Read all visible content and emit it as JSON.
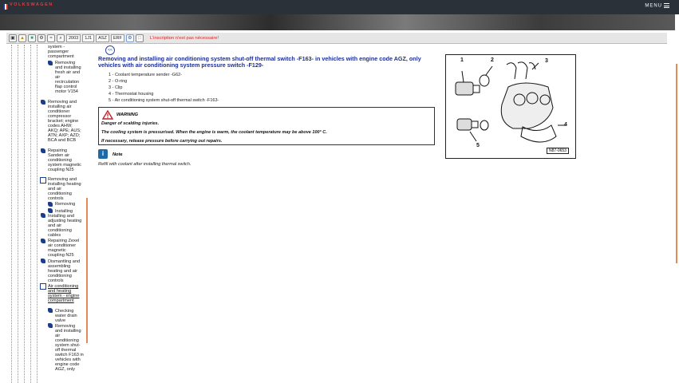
{
  "header": {
    "brand": "VOLKSWAGEN",
    "menu_label": "MENU"
  },
  "toolbar": {
    "icons": [
      "car-icon",
      "warning-icon",
      "engine-icon",
      "gearbox-icon",
      "wiring-icon",
      "search-icon"
    ],
    "year": "2003",
    "model": "1J1",
    "engine": "ASZ",
    "gearbox": "ERF",
    "register_note": "L'inscription n'est pas nécessaire!"
  },
  "tree": {
    "nodes": [
      {
        "text": "system - passenger compartment",
        "level": 1,
        "icon": "none"
      },
      {
        "text": "Removing and installing fresh air and air recirculation flap control motor V154",
        "level": 2,
        "icon": "blue"
      },
      {
        "text": "Removing and installing air conditioner compressor bracket; engine codes AHW; AKQ; APE; AUS; ATN; AXP; AZD; BCA and BCB",
        "level": 1,
        "icon": "blue"
      },
      {
        "text": "Repairing Sanden air conditioning system magnetic coupling N25",
        "level": 1,
        "icon": "blue"
      },
      {
        "text": "Removing and installing heating and air conditioning controls",
        "level": 1,
        "icon": "open"
      },
      {
        "text": "Removing",
        "level": 2,
        "icon": "blue"
      },
      {
        "text": "Installing",
        "level": 2,
        "icon": "blue"
      },
      {
        "text": "Installing and adjusting heating and air conditioning cables",
        "level": 1,
        "icon": "blue"
      },
      {
        "text": "Repairing Zexel air conditioner magnetic coupling N25",
        "level": 1,
        "icon": "blue"
      },
      {
        "text": "Dismantling and assembling heating and air conditioning controls",
        "level": 1,
        "icon": "blue"
      },
      {
        "text": "Air conditioning and heating system - engine compartment",
        "level": 1,
        "icon": "open",
        "link": true
      },
      {
        "text": "Checking water drain valve",
        "level": 2,
        "icon": "blue"
      },
      {
        "text": "Removing and installing air conditioning system shut-off thermal switch F163 in vehicles with engine code AGZ, only",
        "level": 2,
        "icon": "blue"
      }
    ]
  },
  "content": {
    "back_label": "<<",
    "title": "Removing and installing air conditioning system shut-off thermal switch -F163- in vehicles with engine code AGZ, only vehicles with air conditioning system pressure switch -F129-",
    "legend": [
      "1 - Coolant temperature sender -G62-",
      "2 - O-ring",
      "3 - Clip",
      "4 - Thermostat housing",
      "5 - Air conditioning system shut-off thermal switch -F163-"
    ],
    "warning": {
      "title": "WARNING",
      "lines": [
        "Danger of scalding injuries.",
        "The cooling system is pressurised. When the engine is warm, the coolant temperature may be above 100° C.",
        "If necessary, release pressure before carrying out repairs."
      ]
    },
    "note": {
      "title": "Note",
      "text": "Refill with coolant after installing thermal switch."
    },
    "figure": {
      "labels": [
        "1",
        "2",
        "3",
        "4",
        "5"
      ],
      "code": "N87-0653"
    }
  },
  "colors": {
    "title_blue": "#1b2f9a",
    "register_red": "#d22222",
    "scroll_orange": "#e48a5a"
  }
}
